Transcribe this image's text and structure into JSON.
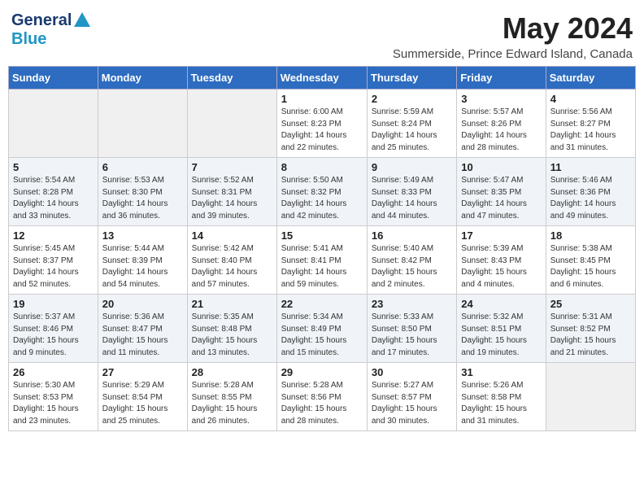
{
  "header": {
    "logo_line1": "General",
    "logo_line2": "Blue",
    "month": "May 2024",
    "location": "Summerside, Prince Edward Island, Canada"
  },
  "weekdays": [
    "Sunday",
    "Monday",
    "Tuesday",
    "Wednesday",
    "Thursday",
    "Friday",
    "Saturday"
  ],
  "weeks": [
    [
      {
        "day": "",
        "info": ""
      },
      {
        "day": "",
        "info": ""
      },
      {
        "day": "",
        "info": ""
      },
      {
        "day": "1",
        "info": "Sunrise: 6:00 AM\nSunset: 8:23 PM\nDaylight: 14 hours\nand 22 minutes."
      },
      {
        "day": "2",
        "info": "Sunrise: 5:59 AM\nSunset: 8:24 PM\nDaylight: 14 hours\nand 25 minutes."
      },
      {
        "day": "3",
        "info": "Sunrise: 5:57 AM\nSunset: 8:26 PM\nDaylight: 14 hours\nand 28 minutes."
      },
      {
        "day": "4",
        "info": "Sunrise: 5:56 AM\nSunset: 8:27 PM\nDaylight: 14 hours\nand 31 minutes."
      }
    ],
    [
      {
        "day": "5",
        "info": "Sunrise: 5:54 AM\nSunset: 8:28 PM\nDaylight: 14 hours\nand 33 minutes."
      },
      {
        "day": "6",
        "info": "Sunrise: 5:53 AM\nSunset: 8:30 PM\nDaylight: 14 hours\nand 36 minutes."
      },
      {
        "day": "7",
        "info": "Sunrise: 5:52 AM\nSunset: 8:31 PM\nDaylight: 14 hours\nand 39 minutes."
      },
      {
        "day": "8",
        "info": "Sunrise: 5:50 AM\nSunset: 8:32 PM\nDaylight: 14 hours\nand 42 minutes."
      },
      {
        "day": "9",
        "info": "Sunrise: 5:49 AM\nSunset: 8:33 PM\nDaylight: 14 hours\nand 44 minutes."
      },
      {
        "day": "10",
        "info": "Sunrise: 5:47 AM\nSunset: 8:35 PM\nDaylight: 14 hours\nand 47 minutes."
      },
      {
        "day": "11",
        "info": "Sunrise: 5:46 AM\nSunset: 8:36 PM\nDaylight: 14 hours\nand 49 minutes."
      }
    ],
    [
      {
        "day": "12",
        "info": "Sunrise: 5:45 AM\nSunset: 8:37 PM\nDaylight: 14 hours\nand 52 minutes."
      },
      {
        "day": "13",
        "info": "Sunrise: 5:44 AM\nSunset: 8:39 PM\nDaylight: 14 hours\nand 54 minutes."
      },
      {
        "day": "14",
        "info": "Sunrise: 5:42 AM\nSunset: 8:40 PM\nDaylight: 14 hours\nand 57 minutes."
      },
      {
        "day": "15",
        "info": "Sunrise: 5:41 AM\nSunset: 8:41 PM\nDaylight: 14 hours\nand 59 minutes."
      },
      {
        "day": "16",
        "info": "Sunrise: 5:40 AM\nSunset: 8:42 PM\nDaylight: 15 hours\nand 2 minutes."
      },
      {
        "day": "17",
        "info": "Sunrise: 5:39 AM\nSunset: 8:43 PM\nDaylight: 15 hours\nand 4 minutes."
      },
      {
        "day": "18",
        "info": "Sunrise: 5:38 AM\nSunset: 8:45 PM\nDaylight: 15 hours\nand 6 minutes."
      }
    ],
    [
      {
        "day": "19",
        "info": "Sunrise: 5:37 AM\nSunset: 8:46 PM\nDaylight: 15 hours\nand 9 minutes."
      },
      {
        "day": "20",
        "info": "Sunrise: 5:36 AM\nSunset: 8:47 PM\nDaylight: 15 hours\nand 11 minutes."
      },
      {
        "day": "21",
        "info": "Sunrise: 5:35 AM\nSunset: 8:48 PM\nDaylight: 15 hours\nand 13 minutes."
      },
      {
        "day": "22",
        "info": "Sunrise: 5:34 AM\nSunset: 8:49 PM\nDaylight: 15 hours\nand 15 minutes."
      },
      {
        "day": "23",
        "info": "Sunrise: 5:33 AM\nSunset: 8:50 PM\nDaylight: 15 hours\nand 17 minutes."
      },
      {
        "day": "24",
        "info": "Sunrise: 5:32 AM\nSunset: 8:51 PM\nDaylight: 15 hours\nand 19 minutes."
      },
      {
        "day": "25",
        "info": "Sunrise: 5:31 AM\nSunset: 8:52 PM\nDaylight: 15 hours\nand 21 minutes."
      }
    ],
    [
      {
        "day": "26",
        "info": "Sunrise: 5:30 AM\nSunset: 8:53 PM\nDaylight: 15 hours\nand 23 minutes."
      },
      {
        "day": "27",
        "info": "Sunrise: 5:29 AM\nSunset: 8:54 PM\nDaylight: 15 hours\nand 25 minutes."
      },
      {
        "day": "28",
        "info": "Sunrise: 5:28 AM\nSunset: 8:55 PM\nDaylight: 15 hours\nand 26 minutes."
      },
      {
        "day": "29",
        "info": "Sunrise: 5:28 AM\nSunset: 8:56 PM\nDaylight: 15 hours\nand 28 minutes."
      },
      {
        "day": "30",
        "info": "Sunrise: 5:27 AM\nSunset: 8:57 PM\nDaylight: 15 hours\nand 30 minutes."
      },
      {
        "day": "31",
        "info": "Sunrise: 5:26 AM\nSunset: 8:58 PM\nDaylight: 15 hours\nand 31 minutes."
      },
      {
        "day": "",
        "info": ""
      }
    ]
  ]
}
